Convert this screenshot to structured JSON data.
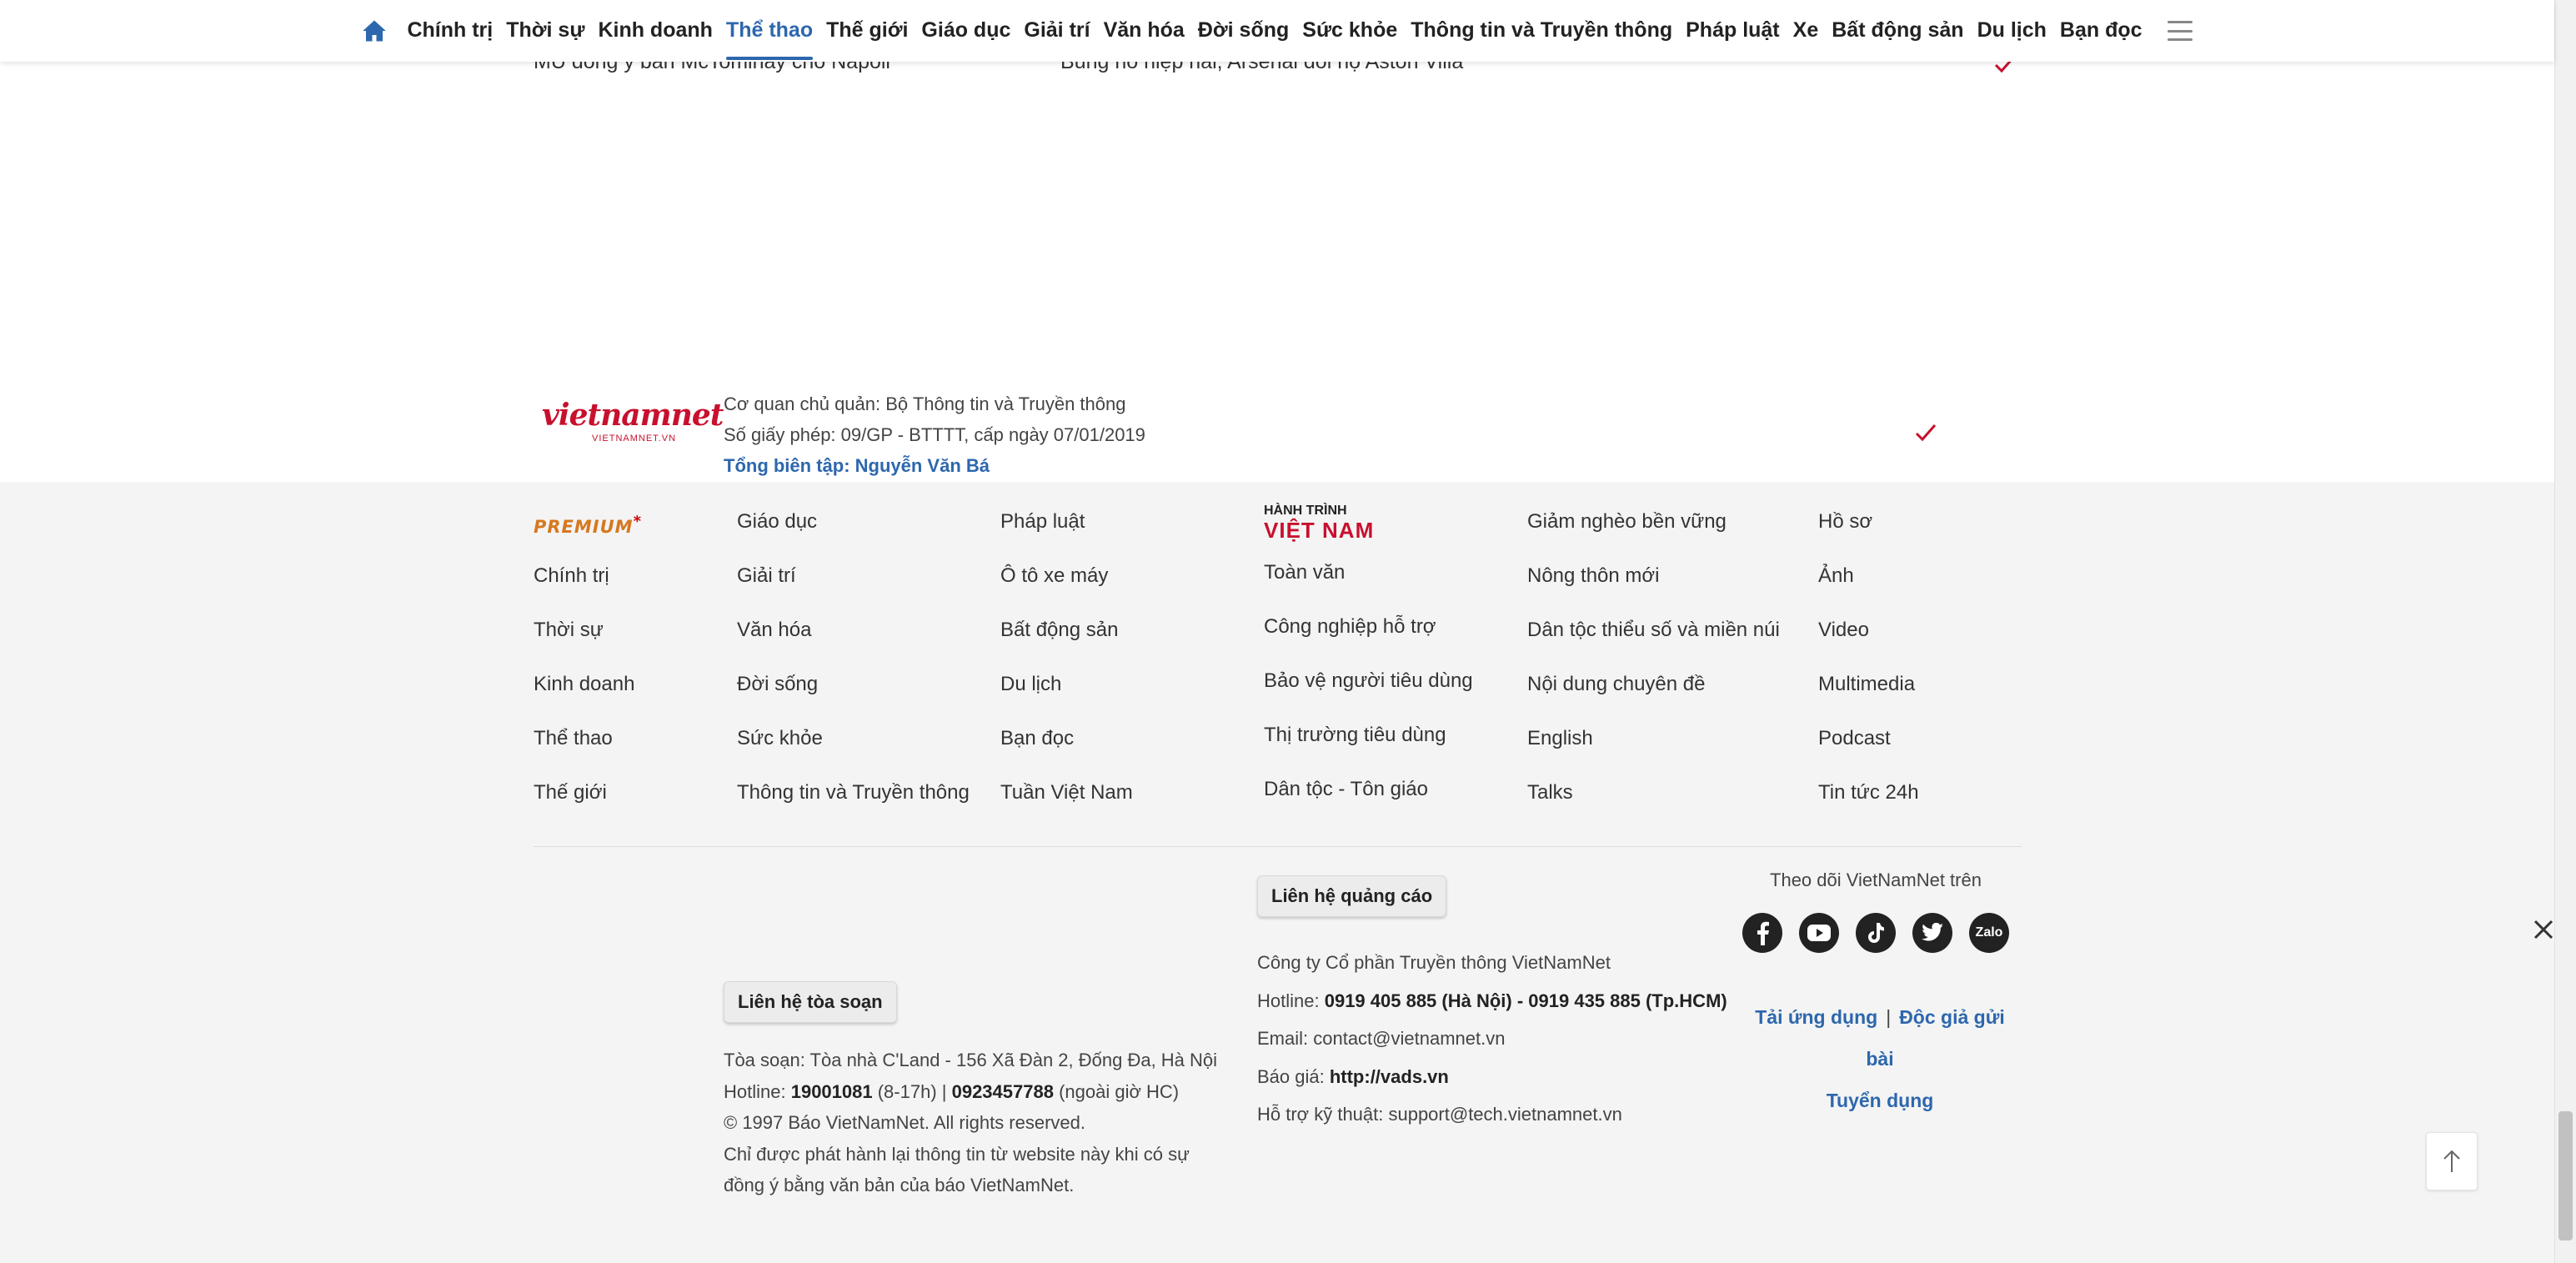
{
  "nav": {
    "items": [
      "Chính trị",
      "Thời sự",
      "Kinh doanh",
      "Thể thao",
      "Thế giới",
      "Giáo dục",
      "Giải trí",
      "Văn hóa",
      "Đời sống",
      "Sức khỏe",
      "Thông tin và Truyền thông",
      "Pháp luật",
      "Xe",
      "Bất động sản",
      "Du lịch",
      "Bạn đọc"
    ],
    "active": "Thể thao",
    "home_icon": "home-icon",
    "menu_icon": "hamburger-icon"
  },
  "headlines": {
    "left": "MU đồng ý bán McTominay cho Napoli",
    "right": "Bùng nổ hiệp hai, Arsenal đối họ Aston Villa"
  },
  "footer": {
    "columns": [
      {
        "premium": "PREMIUM",
        "items": [
          "Chính trị",
          "Thời sự",
          "Kinh doanh",
          "Thể thao",
          "Thế giới"
        ]
      },
      {
        "items": [
          "Giáo dục",
          "Giải trí",
          "Văn hóa",
          "Đời sống",
          "Sức khỏe",
          "Thông tin và Truyền thông"
        ]
      },
      {
        "items": [
          "Pháp luật",
          "Ô tô xe máy",
          "Bất động sản",
          "Du lịch",
          "Bạn đọc",
          "Tuần Việt Nam"
        ]
      },
      {
        "brand_top": "HÀNH TRÌNH",
        "brand_bottom": "VIỆT NAM",
        "items": [
          "Toàn văn",
          "Công nghiệp hỗ trợ",
          "Bảo vệ người tiêu dùng",
          "Thị trường tiêu dùng",
          "Dân tộc - Tôn giáo"
        ]
      },
      {
        "items": [
          "Giảm nghèo bền vững",
          "Nông thôn mới",
          "Dân tộc thiểu số và miền núi",
          "Nội dung chuyên đề",
          "English",
          "Talks"
        ]
      },
      {
        "items": [
          "Hồ sơ",
          "Ảnh",
          "Video",
          "Multimedia",
          "Podcast",
          "Tin tức 24h"
        ]
      }
    ],
    "logo_main": "vietnamnet",
    "logo_sub": "VIETNAMNET.VN",
    "info": {
      "agency": "Cơ quan chủ quản: Bộ Thông tin và Truyền thông",
      "license": "Số giấy phép: 09/GP - BTTTT, cấp ngày 07/01/2019",
      "editor": "Tổng biên tập: Nguyễn Văn Bá",
      "contact_button": "Liên hệ tòa soạn",
      "address": "Tòa soạn: Tòa nhà C'Land - 156 Xã Đàn 2, Đống Đa, Hà Nội",
      "hotline_label": "Hotline: ",
      "hotline_1": "19001081",
      "hotline_1_note": " (8-17h) | ",
      "hotline_2": "0923457788",
      "hotline_2_note": " (ngoài giờ HC)",
      "copyright": "© 1997 Báo VietNamNet. All rights reserved.",
      "reprint": "Chỉ được phát hành lại thông tin từ website này khi có sự đồng ý bằng văn bản của báo VietNamNet."
    },
    "ads": {
      "button": "Liên hệ quảng cáo",
      "company": "Công ty Cổ phần Truyền thông VietNamNet",
      "hotline_label": "Hotline: ",
      "hotline_value": "0919 405 885 (Hà Nội) - 0919 435 885 (Tp.HCM)",
      "email": "Email: contact@vietnamnet.vn",
      "price_label": "Báo giá: ",
      "price_value": "http://vads.vn",
      "support": "Hỗ trợ kỹ thuật: support@tech.vietnamnet.vn"
    },
    "social": {
      "title": "Theo dõi VietNamNet trên",
      "icons": [
        "facebook-icon",
        "youtube-icon",
        "tiktok-icon",
        "twitter-icon",
        "zalo-icon"
      ],
      "zalo_label": "Zalo"
    },
    "app_links": {
      "download": "Tải ứng dụng",
      "separator": "|",
      "submit": "Độc giả gửi bài",
      "jobs": "Tuyển dụng"
    }
  },
  "colors": {
    "accent": "#2d67ad",
    "brand_red": "#c8102e",
    "premium": "#d6781f",
    "footer_bg": "#f4f4f4"
  }
}
